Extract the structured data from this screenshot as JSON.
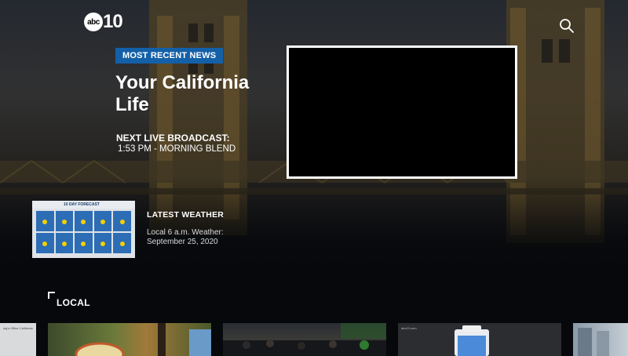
{
  "header": {
    "logo_abc": "abc",
    "logo_num": "10",
    "search_icon": "search-icon"
  },
  "hero": {
    "badge": "MOST RECENT NEWS",
    "title": "Your California Life",
    "next_label": "NEXT LIVE BROADCAST:",
    "next_value": "1:53 PM - MORNING BLEND"
  },
  "weather": {
    "title": "LATEST WEATHER",
    "subtitle": "Local 6 a.m. Weather: September 25, 2020",
    "thumb_header": "10 DAY FORECAST"
  },
  "section": {
    "title": "LOCAL"
  },
  "cards": [
    {
      "caption": "ing's Office California"
    },
    {
      "caption": ""
    },
    {
      "caption": ""
    },
    {
      "caption": "abc10.com"
    },
    {
      "caption": ""
    }
  ],
  "colors": {
    "badge": "#1460a8",
    "background": "#07090d"
  }
}
